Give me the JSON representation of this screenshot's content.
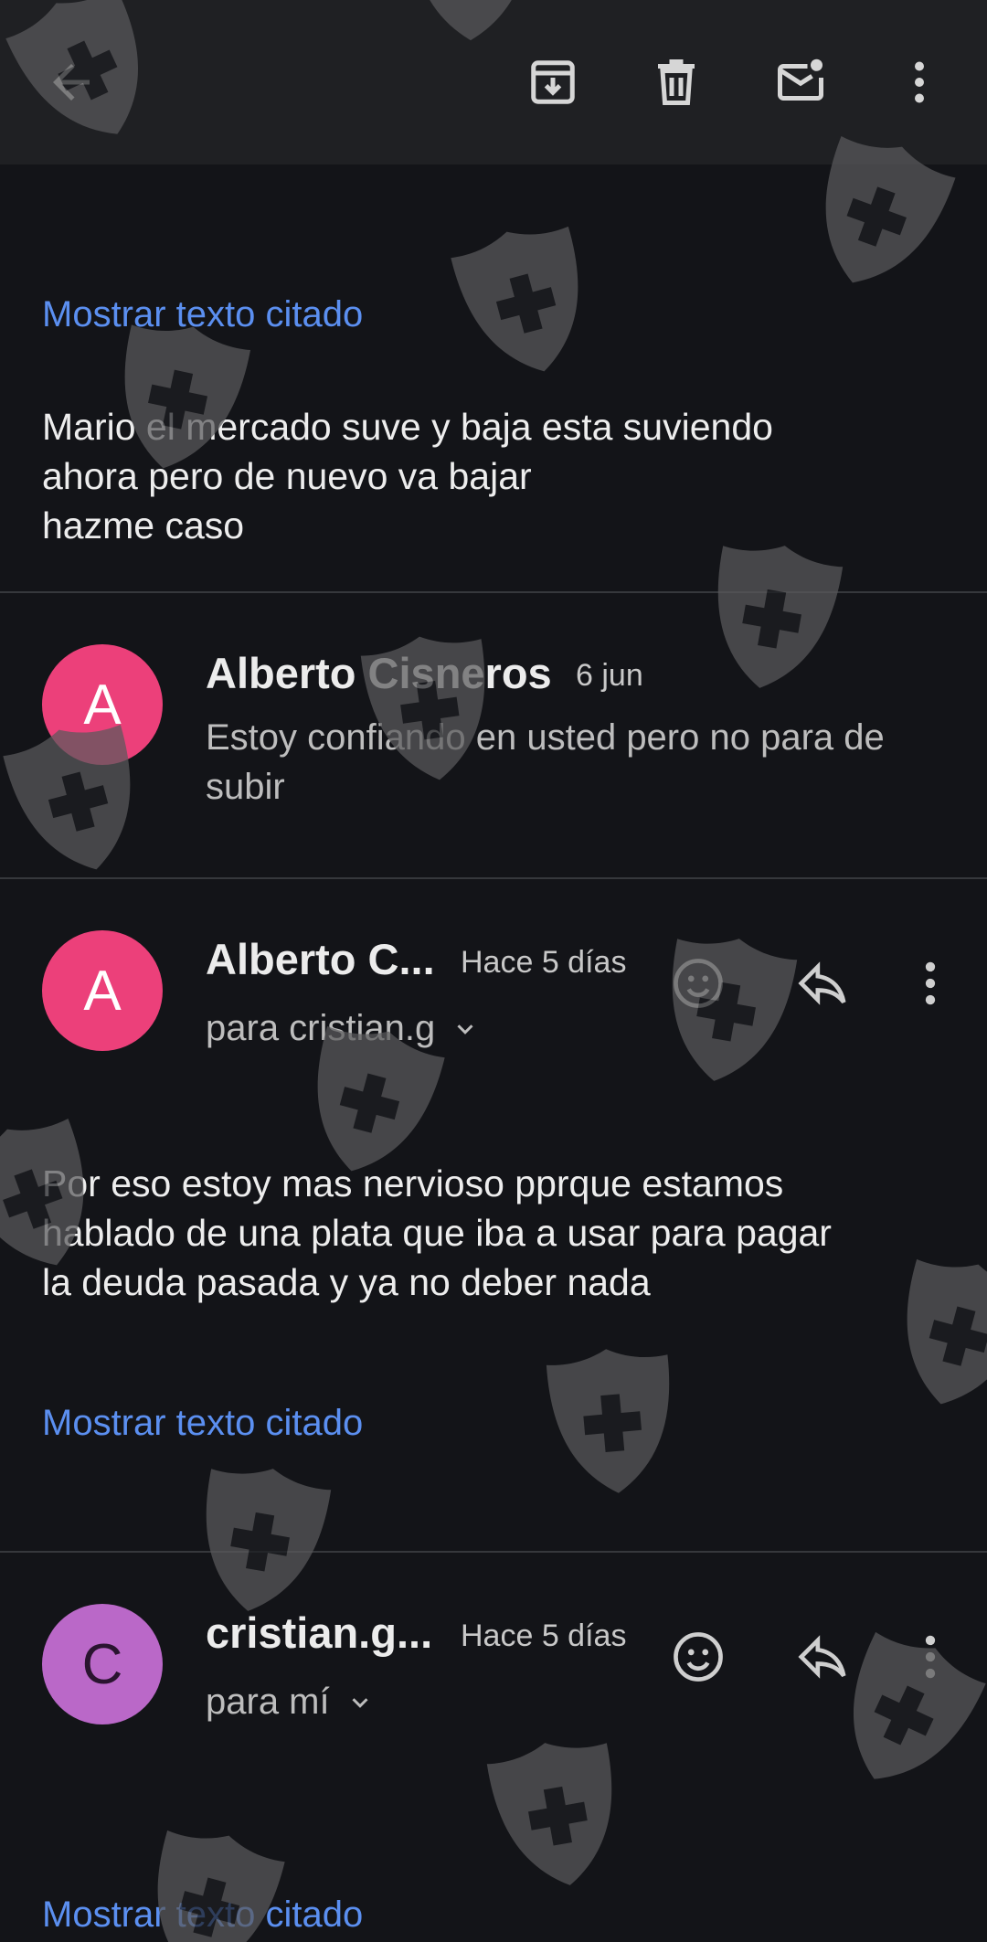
{
  "toolbar": {
    "back": "back-icon",
    "archive": "archive-icon",
    "delete": "delete-icon",
    "mark_unread": "mark-unread-icon",
    "more": "more-vert-icon"
  },
  "quoted_link_1": "Mostrar texto citado",
  "message_top": {
    "body": "Mario el mercado suve y baja esta suviendo\nahora pero de nuevo va bajar\nhazme caso"
  },
  "message_collapsed": {
    "avatar_letter": "A",
    "avatar_color": "#ec407a",
    "sender": "Alberto Cisneros",
    "date": "6 jun",
    "snippet": "Estoy confiando en usted pero no para de subir"
  },
  "message_expanded": {
    "avatar_letter": "A",
    "avatar_color": "#ec407a",
    "sender": "Alberto C...",
    "date": "Hace 5 días",
    "recipient": "para cristian.g",
    "body": "Por eso estoy mas nervioso pprque estamos\nhablado de una plata que iba a usar para pagar\nla deuda pasada y ya no deber nada",
    "quoted_link": "Mostrar texto citado"
  },
  "message_last": {
    "avatar_letter": "C",
    "avatar_color": "#ba68c8",
    "sender": "cristian.g...",
    "date": "Hace 5 días",
    "recipient": "para mí",
    "quoted_link": "Mostrar texto citado"
  },
  "colors": {
    "background": "#131418",
    "toolbar": "#1f2023",
    "link": "#5b8ff0",
    "watermark": "#5a5a5c"
  }
}
